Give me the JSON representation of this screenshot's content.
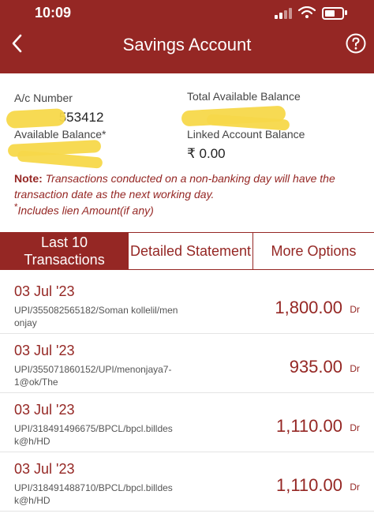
{
  "status_bar": {
    "time": "10:09"
  },
  "header": {
    "title": "Savings Account",
    "back_icon": "chevron-left-icon",
    "help_icon": "help-icon"
  },
  "account": {
    "ac_label": "A/c Number",
    "ac_value": "553412",
    "total_label": "Total Available Balance",
    "available_label": "Available Balance*",
    "linked_label": "Linked Account Balance",
    "linked_value": "₹ 0.00"
  },
  "note": {
    "prefix": "Note:",
    "text": "Transactions conducted on a non-banking day will have the transaction date as the next working day.",
    "lien_star": "*",
    "lien": "Includes lien Amount(if any)"
  },
  "tabs": [
    {
      "line1": "Last 10",
      "line2": "Transactions"
    },
    {
      "label": "Detailed Statement"
    },
    {
      "label": "More Options"
    }
  ],
  "transactions": [
    {
      "date": "03 Jul '23",
      "desc": "UPI/355082565182/Soman kollelil/men onjay",
      "amount": "1,800.00",
      "type": "Dr"
    },
    {
      "date": "03 Jul '23",
      "desc": "UPI/355071860152/UPI/menonjaya7-1@ok/The",
      "amount": "935.00",
      "type": "Dr"
    },
    {
      "date": "03 Jul '23",
      "desc": "UPI/318491496675/BPCL/bpcl.billdes k@h/HD",
      "amount": "1,110.00",
      "type": "Dr"
    },
    {
      "date": "03 Jul '23",
      "desc": "UPI/318491488710/BPCL/bpcl.billdes k@h/HD",
      "amount": "1,110.00",
      "type": "Dr"
    }
  ],
  "colors": {
    "brand": "#952724",
    "redaction": "#f7d84a"
  }
}
